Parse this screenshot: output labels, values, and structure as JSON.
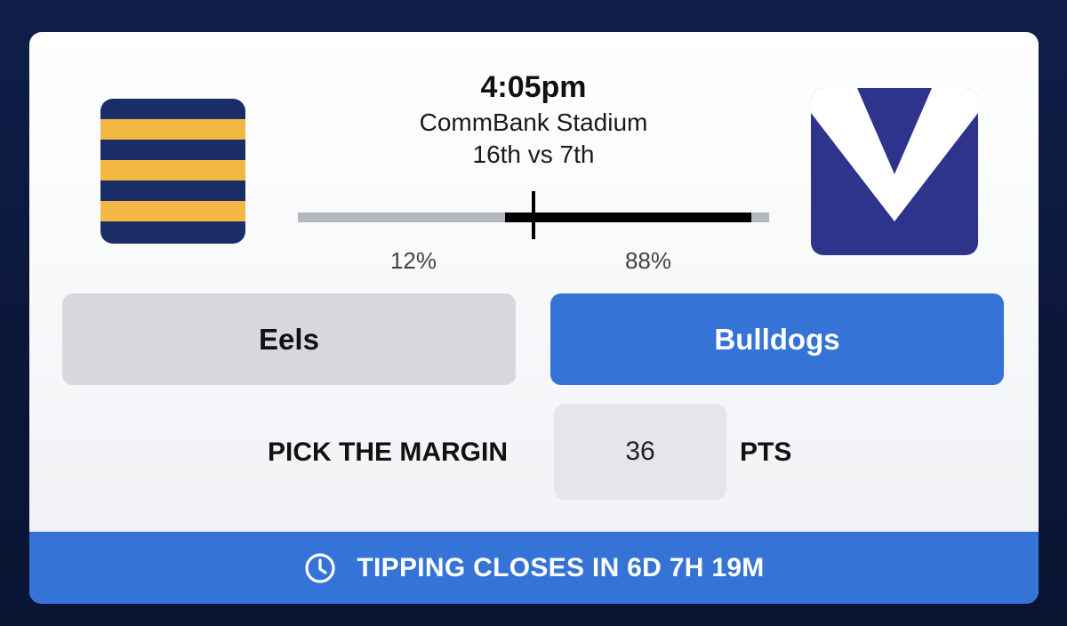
{
  "match": {
    "kickoff_time": "4:05pm",
    "venue": "CommBank Stadium",
    "ladder_positions": "16th vs 7th"
  },
  "home_team": {
    "name": "Eels",
    "tip_percentage_label": "12%",
    "tip_fraction": 0.12,
    "logo_icon": "eels-striped-logo",
    "colors": {
      "primary": "#1b2d66",
      "secondary": "#f2b843"
    }
  },
  "away_team": {
    "name": "Bulldogs",
    "tip_percentage_label": "88%",
    "tip_fraction": 0.88,
    "logo_icon": "bulldogs-v-logo",
    "colors": {
      "primary": "#2e338c",
      "secondary": "#ffffff"
    },
    "selected": true
  },
  "margin": {
    "label": "PICK THE MARGIN",
    "value": "36",
    "unit": "PTS"
  },
  "footer": {
    "icon": "clock-icon",
    "text": "TIPPING CLOSES IN 6D 7H 19M"
  },
  "colors": {
    "accent": "#3574d6",
    "unselected_button": "#d6d8dd",
    "bar_track": "#b3b6bd",
    "bar_fill": "#000000"
  }
}
